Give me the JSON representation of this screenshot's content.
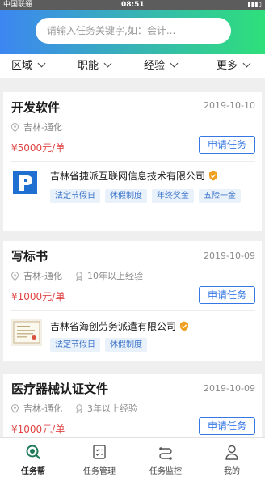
{
  "status_bar": {
    "carrier": "中国联通",
    "time": "08:51"
  },
  "search": {
    "placeholder": "请输入任务关键字,如：会计..."
  },
  "filters": [
    "区域",
    "职能",
    "经验",
    "更多"
  ],
  "tasks": [
    {
      "title": "开发软件",
      "date": "2019-10-10",
      "location": "吉林-通化",
      "experience": "",
      "price": "¥5000元/单",
      "apply_label": "申请任务",
      "company": "吉林省捷派互联网信息技术有限公司",
      "tags": [
        "法定节假日",
        "休假制度",
        "年终奖金",
        "五险一金"
      ]
    },
    {
      "title": "写标书",
      "date": "2019-10-09",
      "location": "吉林-通化",
      "experience": "10年以上经验",
      "price": "¥1000元/单",
      "apply_label": "申请任务",
      "company": "吉林省海创劳务派遣有限公司",
      "tags": [
        "法定节假日",
        "休假制度"
      ]
    },
    {
      "title": "医疗器械认证文件",
      "date": "2019-10-09",
      "location": "吉林-通化",
      "experience": "3年以上经验",
      "price": "¥1000元/单",
      "apply_label": "申请任务"
    }
  ],
  "tabbar": [
    {
      "label": "任务帮",
      "icon": "search-task-icon",
      "active": true
    },
    {
      "label": "任务管理",
      "icon": "checklist-icon",
      "active": false
    },
    {
      "label": "任务监控",
      "icon": "monitor-icon",
      "active": false
    },
    {
      "label": "我的",
      "icon": "user-icon",
      "active": false
    }
  ],
  "colors": {
    "accent": "#3578e5",
    "price": "#e04444",
    "verified": "#f0a020"
  }
}
